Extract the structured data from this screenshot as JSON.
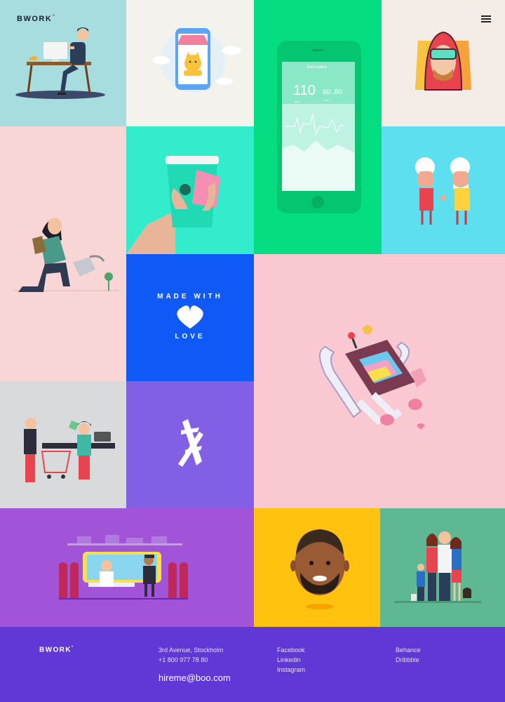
{
  "header": {
    "logo": "BWORK",
    "logo_mark": "°",
    "menu_icon": "hamburger-menu-icon"
  },
  "tiles": {
    "phone_mockup": {
      "title": "Bed Landing",
      "bpm": "110",
      "bpm_unit": "bpm",
      "pressure": "60..80",
      "pressure_unit": "mm"
    },
    "made_with_love": {
      "ring_text_top": "MADE WITH",
      "ring_text_bottom": "LOVE"
    }
  },
  "colors": {
    "tile_desk": "#a8dde0",
    "tile_shop": "#f3f2ed",
    "tile_phone": "#05dd83",
    "tile_vr": "#f4ece6",
    "tile_gardener": "#f9d6d6",
    "tile_cup": "#33eccb",
    "tile_elders": "#5ddfef",
    "tile_love": "#0f59f7",
    "tile_robot": "#fac8d0",
    "tile_shopping": "#d8dadc",
    "tile_x": "#8260e6",
    "tile_train": "#a154d8",
    "tile_face": "#ffc20e",
    "tile_family": "#5fb894",
    "footer": "#6138d6"
  },
  "footer": {
    "logo": "BWORK",
    "logo_mark": "°",
    "address_line1": "3rd Avenue, Stockholm",
    "address_line2": "+1 800 977 78 80",
    "email": "hireme@boo.com",
    "social_col1": [
      "Facebook",
      "Linkedin",
      "Instagram"
    ],
    "social_col2": [
      "Behance",
      "Dribbble"
    ]
  }
}
